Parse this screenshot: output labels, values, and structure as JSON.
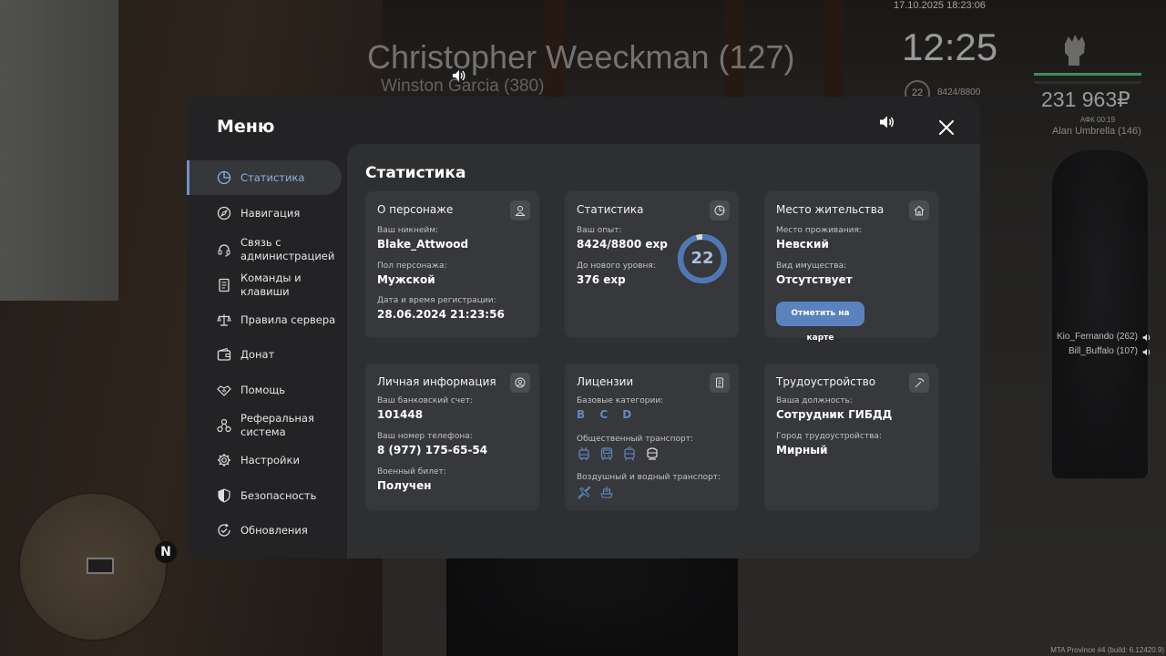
{
  "hud": {
    "datetime": "17.10.2025 18:23:06",
    "clock": "12:25",
    "money": "231 963₽",
    "afk": "АФК 00:19",
    "level": "22",
    "exp": "8424/8800",
    "nearby_name": "Alan Umbrella (146)",
    "nametag_main": "Christopher Weeckman (127)",
    "nametag_secondary": "Winston Garcia (380)",
    "players": [
      "Kio_Fernando (262)",
      "Bill_Buffalo (107)"
    ],
    "build": "MTA Province #4 (build: 6.12420.9)",
    "minimap_north": "N"
  },
  "menu": {
    "title": "Меню",
    "sidebar": [
      {
        "label": "Статистика",
        "icon": "pie-chart-icon",
        "active": true
      },
      {
        "label": "Навигация",
        "icon": "compass-icon"
      },
      {
        "label": "Связь с администрацией",
        "icon": "headset-icon"
      },
      {
        "label": "Команды и клавиши",
        "icon": "document-icon"
      },
      {
        "label": "Правила сервера",
        "icon": "scales-icon"
      },
      {
        "label": "Донат",
        "icon": "wallet-icon"
      },
      {
        "label": "Помощь",
        "icon": "handshake-icon"
      },
      {
        "label": "Реферальная система",
        "icon": "network-icon"
      },
      {
        "label": "Настройки",
        "icon": "gear-icon"
      },
      {
        "label": "Безопасность",
        "icon": "shield-icon"
      },
      {
        "label": "Обновления",
        "icon": "refresh-check-icon"
      }
    ],
    "content_title": "Статистика",
    "cards": {
      "character": {
        "title": "О персонаже",
        "nickname_label": "Ваш никнейм:",
        "nickname": "Blake_Attwood",
        "gender_label": "Пол персонажа:",
        "gender": "Мужской",
        "registered_label": "Дата и время регистрации:",
        "registered": "28.06.2024 21:23:56"
      },
      "stats": {
        "title": "Статистика",
        "exp_label": "Ваш опыт:",
        "exp": "8424/8800 exp",
        "next_label": "До нового уровня:",
        "next": "376 exp",
        "level": "22",
        "level_progress": 0.957
      },
      "residence": {
        "title": "Место жительства",
        "place_label": "Место проживания:",
        "place": "Невский",
        "property_label": "Вид имущества:",
        "property": "Отсутствует",
        "map_button": "Отметить на карте"
      },
      "personal": {
        "title": "Личная информация",
        "bank_label": "Ваш банковский счет:",
        "bank": "101448",
        "phone_label": "Ваш номер телефона:",
        "phone": "8 (977) 175-65-54",
        "military_label": "Военный билет:",
        "military": "Получен"
      },
      "licenses": {
        "title": "Лицензии",
        "basic_label": "Базовые категории:",
        "basic": "B C D",
        "public_label": "Общественный транспорт:",
        "air_water_label": "Воздушный и водный транспорт:"
      },
      "job": {
        "title": "Трудоустройство",
        "position_label": "Ваша должность:",
        "position": "Сотрудник ГИБДД",
        "city_label": "Город трудоустройства:",
        "city": "Мирный"
      }
    }
  },
  "colors": {
    "accent": "#5a82bf",
    "accent_light": "#8fb1e0",
    "panel": "#232325",
    "content": "#2e2f31",
    "card": "#37383b"
  }
}
